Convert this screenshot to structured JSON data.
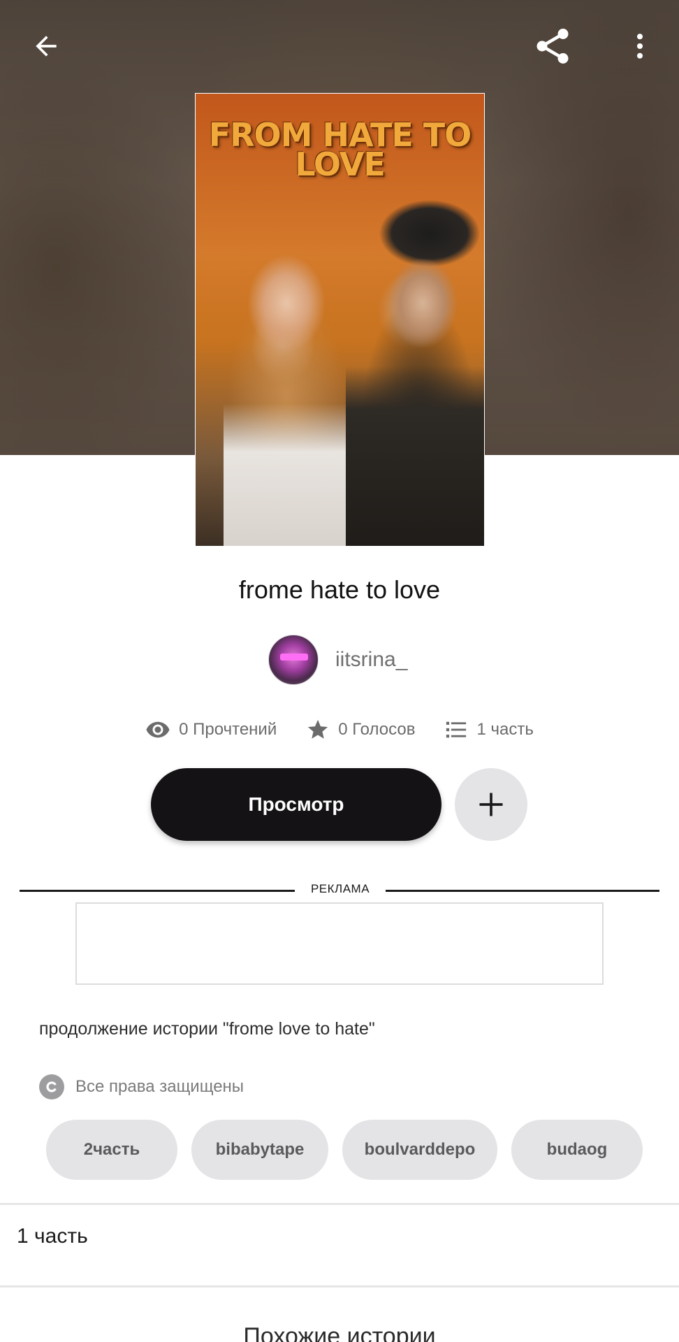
{
  "header": {
    "back_icon": "arrow-left-icon",
    "share_icon": "share-icon",
    "more_icon": "more-vertical-icon"
  },
  "cover": {
    "title_text": "FROM HATE TO LOVE"
  },
  "story": {
    "title": "frome hate to love",
    "author": "iitsrina_",
    "stats": {
      "reads": "0 Прочтений",
      "votes": "0 Голосов",
      "parts": "1 часть"
    },
    "read_button": "Просмотр",
    "ad_label": "РЕКЛАМА",
    "description": "продолжение истории \"frome love to hate\"",
    "copyright": "Все права защищены",
    "tags": [
      "2часть",
      "bibabytape",
      "boulvarddepo",
      "budaog"
    ],
    "parts_row": "1 часть",
    "similar_title": "Похожие истории"
  },
  "colors": {
    "read_button_bg": "#141214",
    "tag_bg": "#e4e3e6",
    "muted_text": "#6b6b6b"
  }
}
